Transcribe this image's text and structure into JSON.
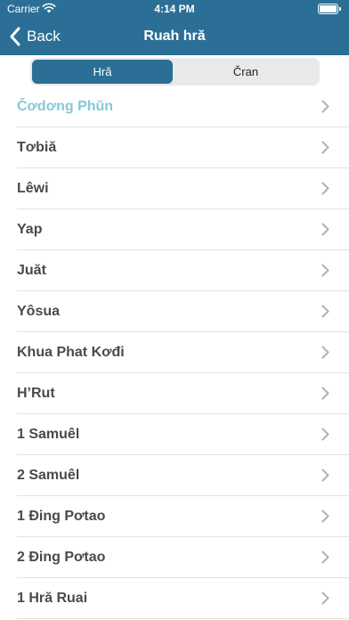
{
  "status": {
    "carrier": "Carrier",
    "time": "4:14 PM",
    "battery_level": 1.0
  },
  "nav": {
    "back_label": "Back",
    "title": "Ruah hră"
  },
  "segments": {
    "selected": "Hră",
    "other": "Čran"
  },
  "books": [
    "Čơdơng Phŭn",
    "Tơbiă",
    "Lêwi",
    "Yap",
    "Juăt",
    "Yôsua",
    "Khua Phat Kơđi",
    "H’Rut",
    "1 Samuêl",
    "2 Samuêl",
    "1 Đing Pơtao",
    "2 Đing Pơtao",
    "1 Hră Ruai"
  ],
  "colors": {
    "header": "#2b6f96",
    "active_row": "#85c8d8"
  }
}
